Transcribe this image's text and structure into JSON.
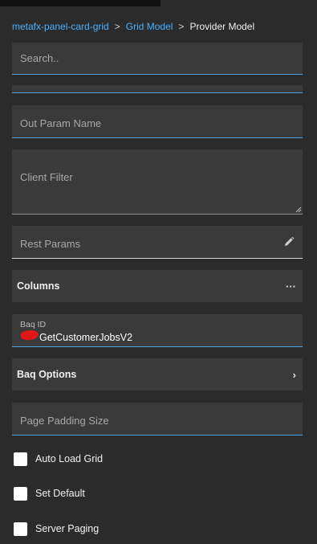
{
  "breadcrumb": {
    "items": [
      "metafx-panel-card-grid",
      "Grid Model"
    ],
    "separator": ">",
    "current": "Provider Model"
  },
  "search": {
    "placeholder": "Search.."
  },
  "fields": {
    "out_param_name": "Out Param Name",
    "client_filter": "Client Filter",
    "rest_params": "Rest Params",
    "page_padding_size": "Page Padding Size"
  },
  "sections": {
    "columns": {
      "label": "Columns",
      "trail": "···"
    },
    "baq_options": {
      "label": "Baq Options",
      "trail": "›"
    }
  },
  "baq_id": {
    "label": "Baq ID",
    "value": "GetCustomerJobsV2"
  },
  "checkboxes": {
    "auto_load_grid": "Auto Load Grid",
    "set_default": "Set Default",
    "server_paging": "Server Paging"
  },
  "colors": {
    "accent": "#4da3e6",
    "link": "#4ab0ff",
    "panel": "#3a3a3a",
    "background": "#2b2b2b"
  },
  "icons": {
    "rest_params": "pencil-icon",
    "columns": "ellipsis-icon",
    "baq_options": "chevron-right-icon"
  }
}
